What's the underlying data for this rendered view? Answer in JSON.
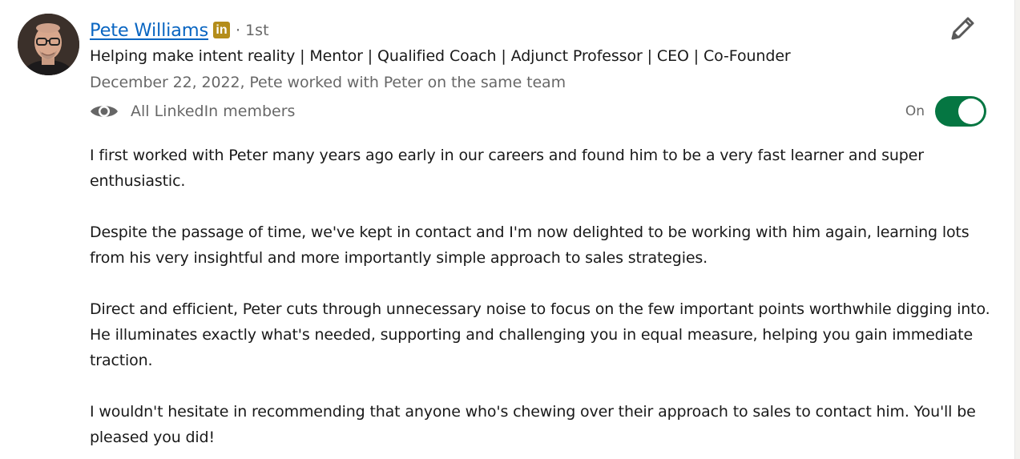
{
  "recommender": {
    "name": "Pete Williams",
    "badge_icon": "linkedin-premium-icon",
    "badge_text": "in",
    "badge_color": "#b48d1a",
    "degree": "· 1st",
    "headline": "Helping make intent reality | Mentor | Qualified Coach | Adjunct Professor | CEO | Co-Founder",
    "meta": "December 22, 2022, Pete worked with Peter on the same team"
  },
  "visibility": {
    "icon": "eye-icon",
    "label": "All LinkedIn members",
    "toggle_label": "On",
    "toggle_on": true,
    "toggle_color": "#057642"
  },
  "actions": {
    "edit_icon": "pencil-icon"
  },
  "recommendation": {
    "paragraphs": [
      "I first worked with Peter many years ago early in our careers and found him to be a very fast learner and super enthusiastic.",
      "Despite the passage of time, we've kept in contact and I'm now delighted to be working with him again, learning lots from his very insightful and more importantly simple approach to sales strategies.",
      "Direct and efficient, Peter cuts through unnecessary noise to focus on the few important points worthwhile digging into. He illuminates exactly what's needed, supporting and challenging you in equal measure, helping you gain immediate traction.",
      "I wouldn't hesitate in recommending that anyone who's chewing over their approach to sales to contact him. You'll be pleased you did!"
    ]
  },
  "colors": {
    "link": "#0a66c2",
    "text": "#191919",
    "muted": "#666666"
  }
}
